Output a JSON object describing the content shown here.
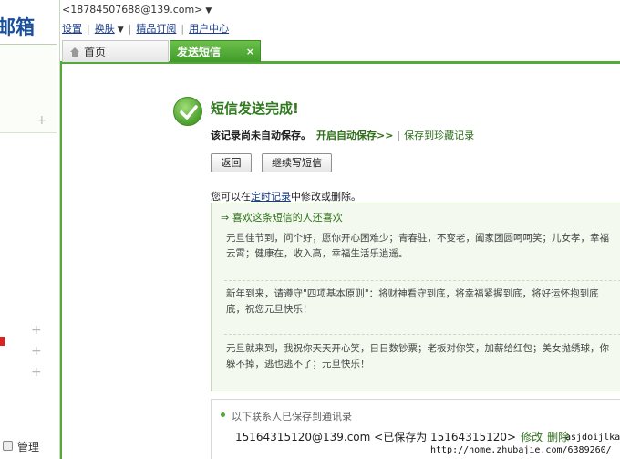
{
  "sidebar": {
    "logo_text": "邮箱",
    "manage_label": "管理"
  },
  "header": {
    "email": "<18784507688@139.com>",
    "links": [
      "设置",
      "换肤",
      "精品订阅",
      "用户中心"
    ]
  },
  "tabs": [
    {
      "label": "首页"
    },
    {
      "label": "发送短信",
      "close": "×"
    }
  ],
  "result": {
    "title": "短信发送完成!",
    "not_saved_text": "该记录尚未自动保存。",
    "auto_save_link": "开启自动保存>>",
    "save_fav_link": "保存到珍藏记录",
    "back_button": "返回",
    "continue_button": "继续写短信",
    "edit_note_prefix": "您可以在",
    "edit_note_link": "定时记录",
    "edit_note_suffix": "中修改或删除。"
  },
  "recommend": {
    "heading": "⇒ 喜欢这条短信的人还喜欢",
    "messages": [
      {
        "line1": "元旦佳节到，问个好，愿你开心困难少；青春驻，不变老，阖家团圆呵呵笑；儿女孝，幸福",
        "line2": "云霄；健康在，收入高，幸福生活乐逍遥。"
      },
      {
        "line1": "新年到来，请遵守\"四项基本原则\"：将财神看守到底，将幸福紧握到底，将好运怀抱到底",
        "line2": "底，祝您元旦快乐！"
      },
      {
        "line1": "元旦就来到，我祝你天天开心笑，日日数钞票；老板对你笑，加薪给红包；美女抛绣球，你",
        "line2": "躲不掉，逃也逃不了；元旦快乐！"
      }
    ]
  },
  "saved": {
    "heading": "以下联系人已保存到通讯录",
    "contact": "15164315120@139.com <已保存为 15164315120>",
    "edit": "修改",
    "delete": "删除"
  },
  "watermark": {
    "user": "asjdoijlka",
    "url": "http://home.zhubajie.com/6389260/"
  },
  "colors": {
    "accent_green": "#55a83a",
    "title_green": "#2f7a1f",
    "link_blue": "#1a3c8a",
    "panel_bg": "#f3f9ee"
  }
}
